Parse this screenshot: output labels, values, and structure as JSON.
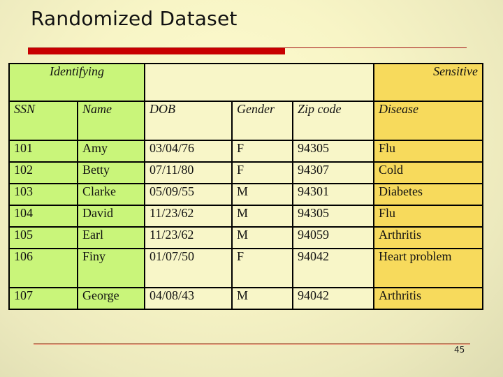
{
  "slide": {
    "title": "Randomized Dataset",
    "page_number": "45"
  },
  "table": {
    "groups": {
      "identifying": "Identifying",
      "middle": "",
      "sensitive": "Sensitive"
    },
    "columns": [
      "SSN",
      "Name",
      "DOB",
      "Gender",
      "Zip code",
      "Disease"
    ],
    "rows": [
      [
        "101",
        "Amy",
        "03/04/76",
        "F",
        "94305",
        "Flu"
      ],
      [
        "102",
        "Betty",
        "07/11/80",
        "F",
        "94307",
        "Cold"
      ],
      [
        "103",
        "Clarke",
        "05/09/55",
        "M",
        "94301",
        "Diabetes"
      ],
      [
        "104",
        "David",
        "11/23/62",
        "M",
        "94305",
        "Flu"
      ],
      [
        "105",
        "Earl",
        "11/23/62",
        "M",
        "94059",
        "Arthritis"
      ],
      [
        "106",
        "Finy",
        "01/07/50",
        "F",
        "94042",
        "Heart problem"
      ],
      [
        "107",
        "George",
        "04/08/43",
        "M",
        "94042",
        "Arthritis"
      ]
    ],
    "colors": {
      "identifying": "#c9f57a",
      "quasi": "#f8f6c8",
      "sensitive": "#f7da5c"
    }
  }
}
